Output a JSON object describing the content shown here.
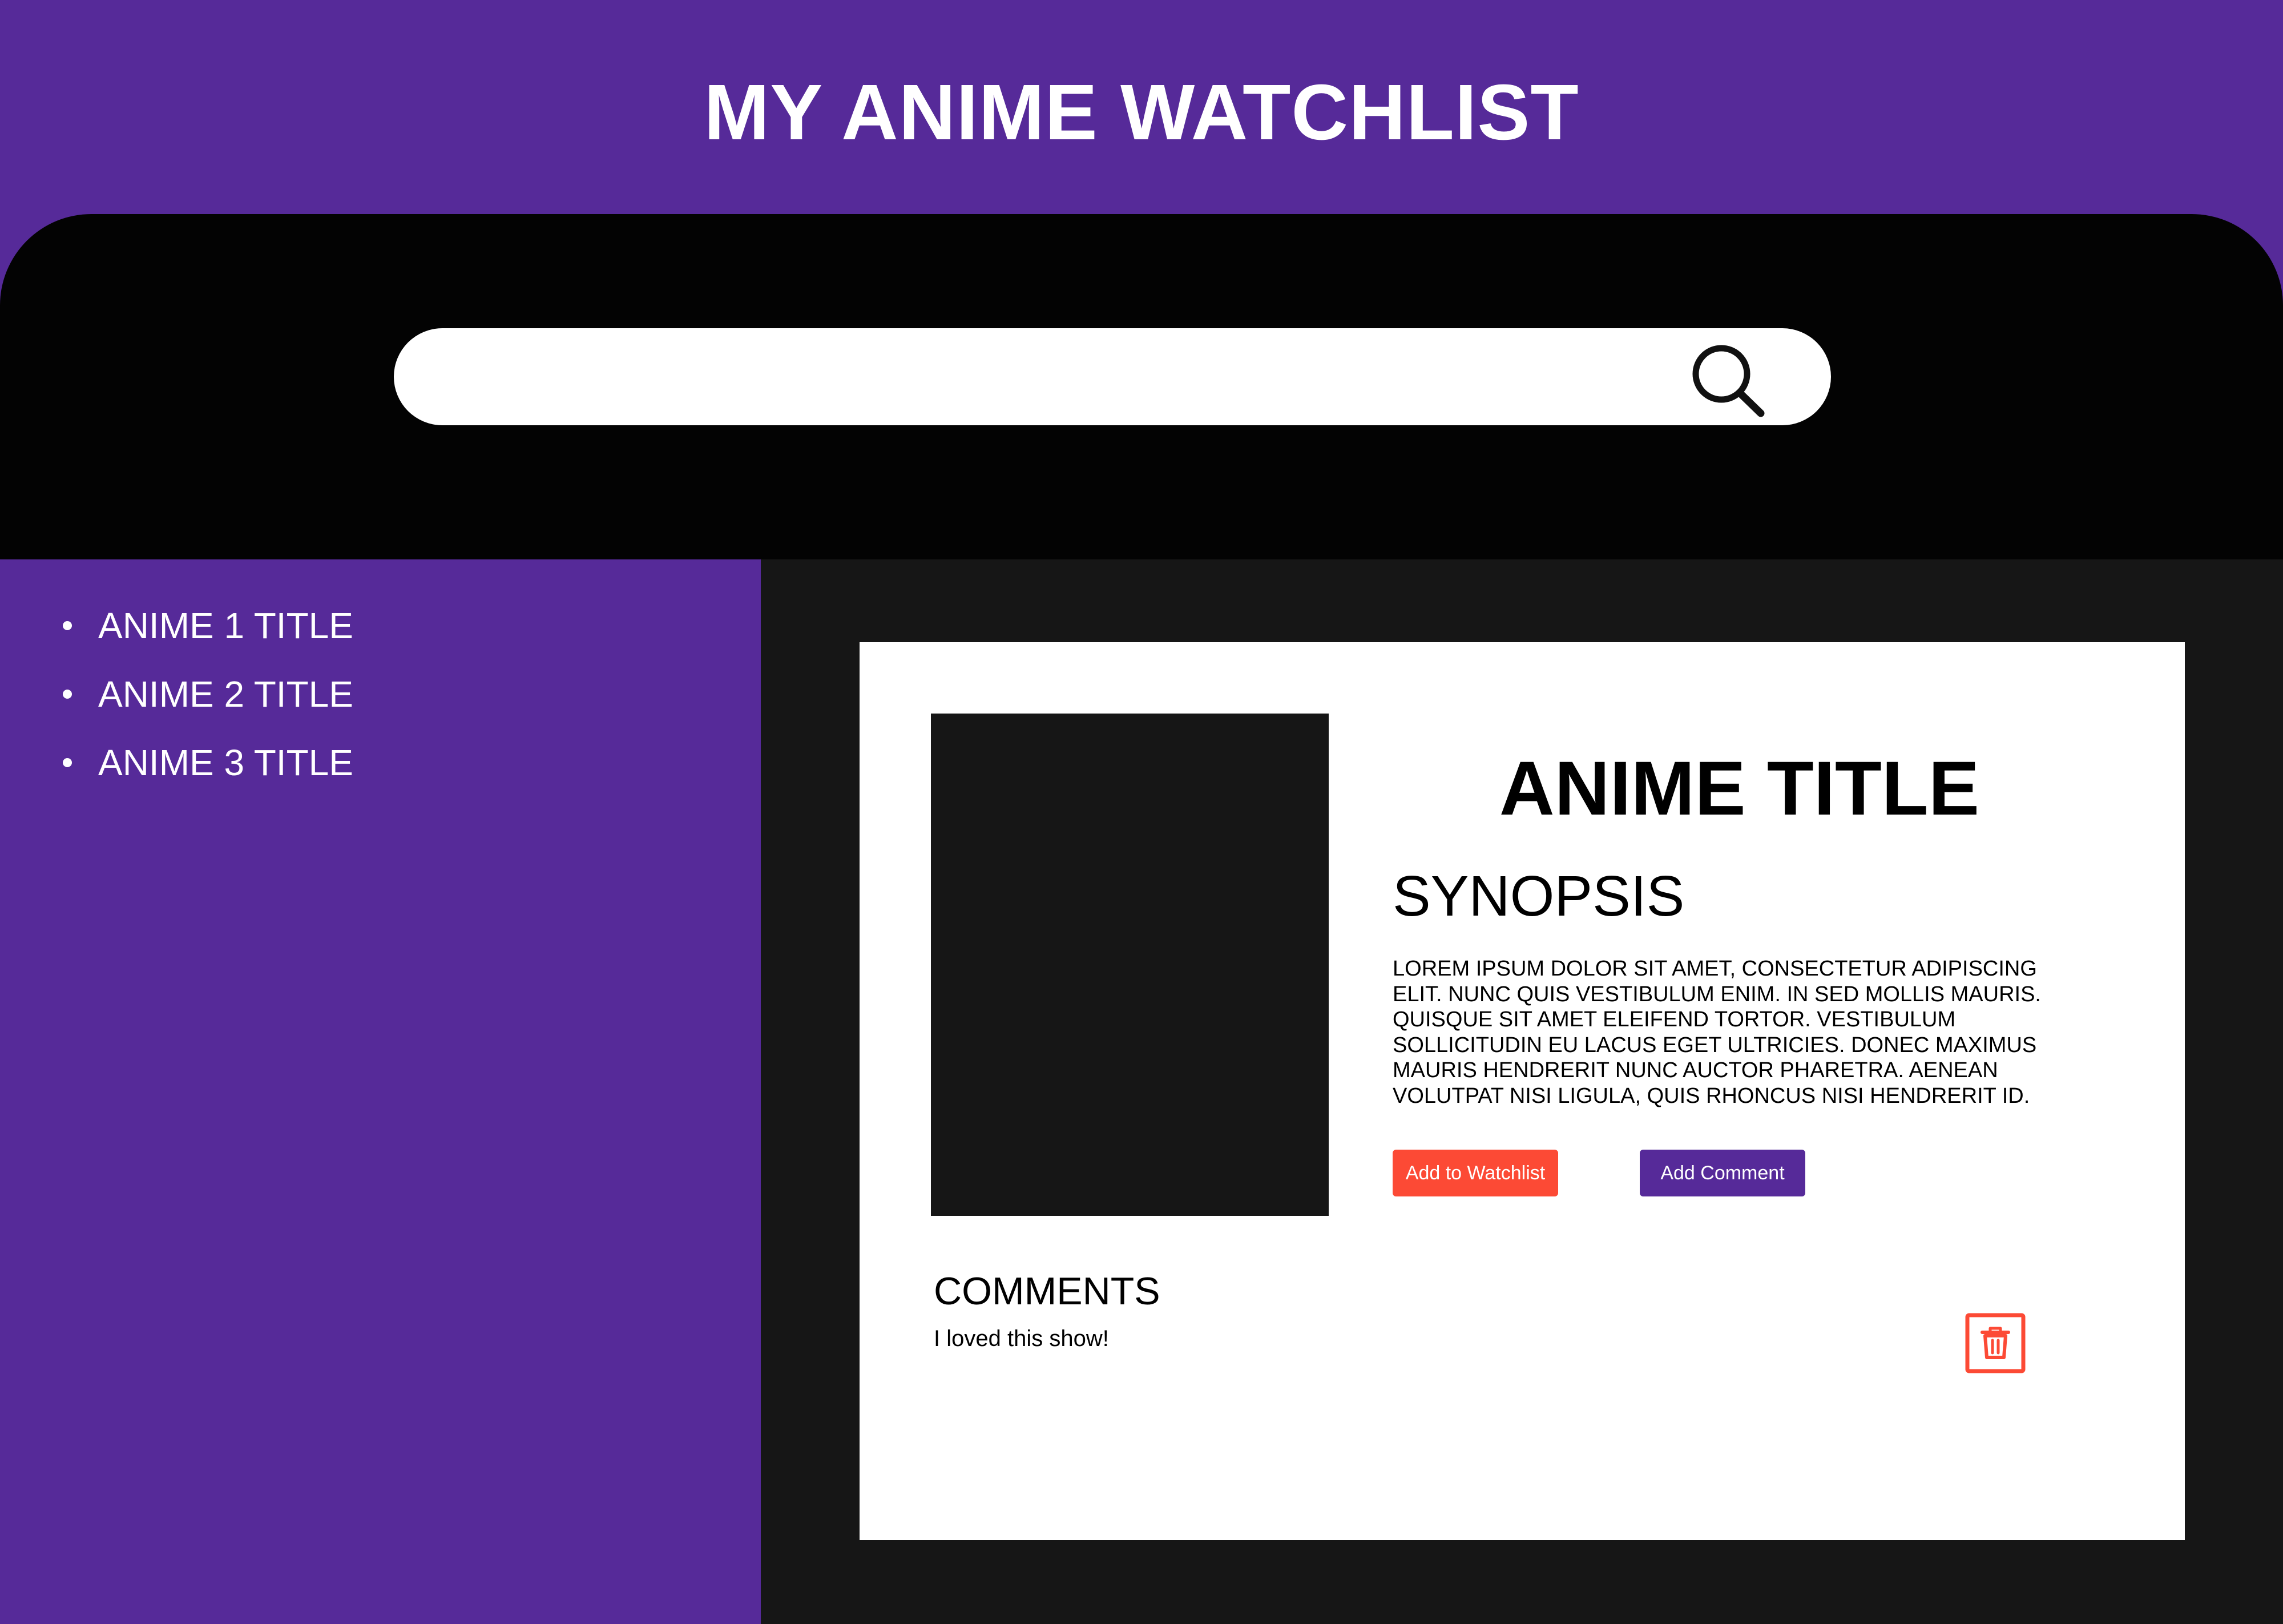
{
  "app": {
    "title": "MY ANIME WATCHLIST"
  },
  "search": {
    "placeholder": "",
    "value": "",
    "icon": "search-icon"
  },
  "sidebar": {
    "items": [
      {
        "label": "ANIME 1 TITLE"
      },
      {
        "label": "ANIME 2 TITLE"
      },
      {
        "label": "ANIME 3 TITLE"
      }
    ]
  },
  "detail": {
    "title": "ANIME TITLE",
    "synopsis_heading": "SYNOPSIS",
    "synopsis": "LOREM IPSUM DOLOR SIT AMET, CONSECTETUR ADIPISCING ELIT. NUNC QUIS VESTIBULUM ENIM. IN SED MOLLIS MAURIS. QUISQUE SIT AMET ELEIFEND TORTOR. VESTIBULUM SOLLICITUDIN EU LACUS EGET ULTRICIES. DONEC MAXIMUS MAURIS HENDRERIT NUNC AUCTOR PHARETRA. AENEAN VOLUTPAT NISI LIGULA, QUIS RHONCUS NISI HENDRERIT ID.",
    "add_watchlist_label": "Add to Watchlist",
    "add_comment_label": "Add Comment"
  },
  "comments": {
    "heading": "COMMENTS",
    "items": [
      {
        "text": "I loved this show!",
        "icon": "trash-icon"
      }
    ]
  },
  "colors": {
    "brand_purple": "#562a99",
    "search_band": "#030303",
    "main_bg": "#161616",
    "card_bg": "#ffffff",
    "accent_red": "#fc4a35"
  }
}
